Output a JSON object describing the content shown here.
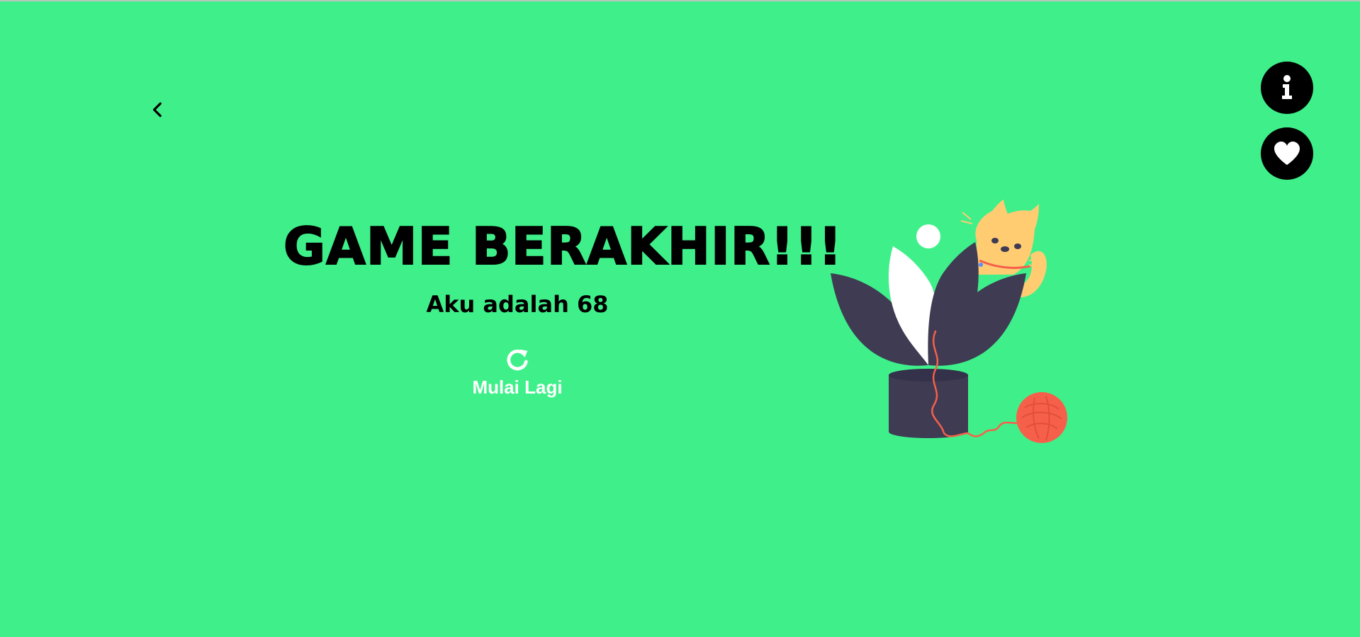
{
  "page": {
    "background_color": "#3ff08a",
    "title": "GAME BERAKHIR!!!",
    "subtitle": "Aku adalah 68",
    "restart_label": "Mulai Lagi"
  },
  "icons": {
    "back": "chevron-left-icon",
    "info": "info-icon",
    "favorite": "heart-icon",
    "restart": "refresh-icon"
  },
  "colors": {
    "button_bg": "#000000",
    "text": "#000000",
    "restart_text": "#ffffff",
    "plant_dark": "#3e3b53",
    "cat": "#ffcc72",
    "yarn": "#f6604b"
  }
}
